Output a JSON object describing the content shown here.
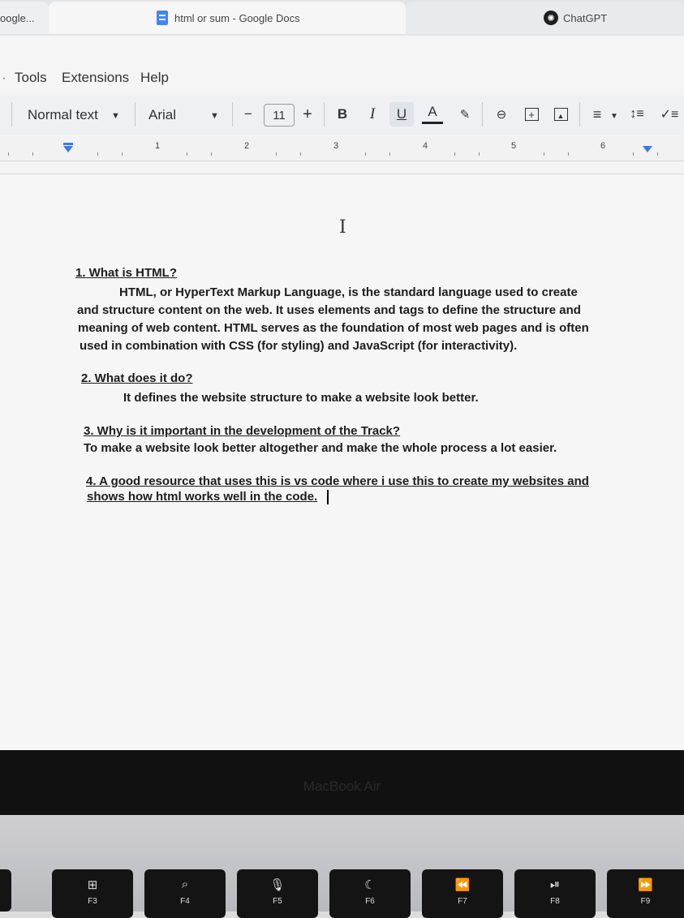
{
  "browser": {
    "tabs": [
      {
        "label": "oogle..."
      },
      {
        "label": "html or sum - Google Docs"
      },
      {
        "label": "ChatGPT"
      }
    ]
  },
  "menu": [
    "Tools",
    "Extensions",
    "Help"
  ],
  "toolbar": {
    "style": "Normal text",
    "font": "Arial",
    "minus": "−",
    "font_size": "11",
    "plus": "+",
    "bold": "B",
    "italic": "I",
    "underline": "U",
    "text_color": "A"
  },
  "ruler": {
    "marks": [
      "1",
      "2",
      "3",
      "4",
      "5",
      "6"
    ]
  },
  "document": {
    "q1_heading": "1. What is HTML?",
    "q1_lines": [
      "HTML, or HyperText Markup Language, is the standard language used to create",
      "and structure content on the web. It uses elements and tags to define the structure and",
      "meaning of web content. HTML serves as the foundation of most web pages and is often",
      "used in combination with CSS (for styling) and JavaScript (for interactivity)."
    ],
    "q2_heading": "2. What does it do?",
    "q2_answer": "It defines the website structure to make a website look better.",
    "q3_heading": "3. Why is it important in the development of the Track?",
    "q3_answer": "To make a website look better altogether and make the whole process a lot easier.",
    "q4_lines": [
      "4. A good resource that uses this is vs code where i use this to create my websites and",
      "shows how html works well in the code."
    ]
  },
  "laptop": {
    "model": "MacBook Air",
    "keys": [
      {
        "icon": "⊞",
        "label": "F3"
      },
      {
        "icon": "⌕",
        "label": "F4"
      },
      {
        "icon": "🎙",
        "label": "F5"
      },
      {
        "icon": "☾",
        "label": "F6"
      },
      {
        "icon": "⏪",
        "label": "F7"
      },
      {
        "icon": "⏯",
        "label": "F8"
      },
      {
        "icon": "⏩",
        "label": "F9"
      }
    ]
  },
  "colors": {
    "docs_blue": "#4285f4",
    "ruler_marker": "#3b78e7"
  }
}
